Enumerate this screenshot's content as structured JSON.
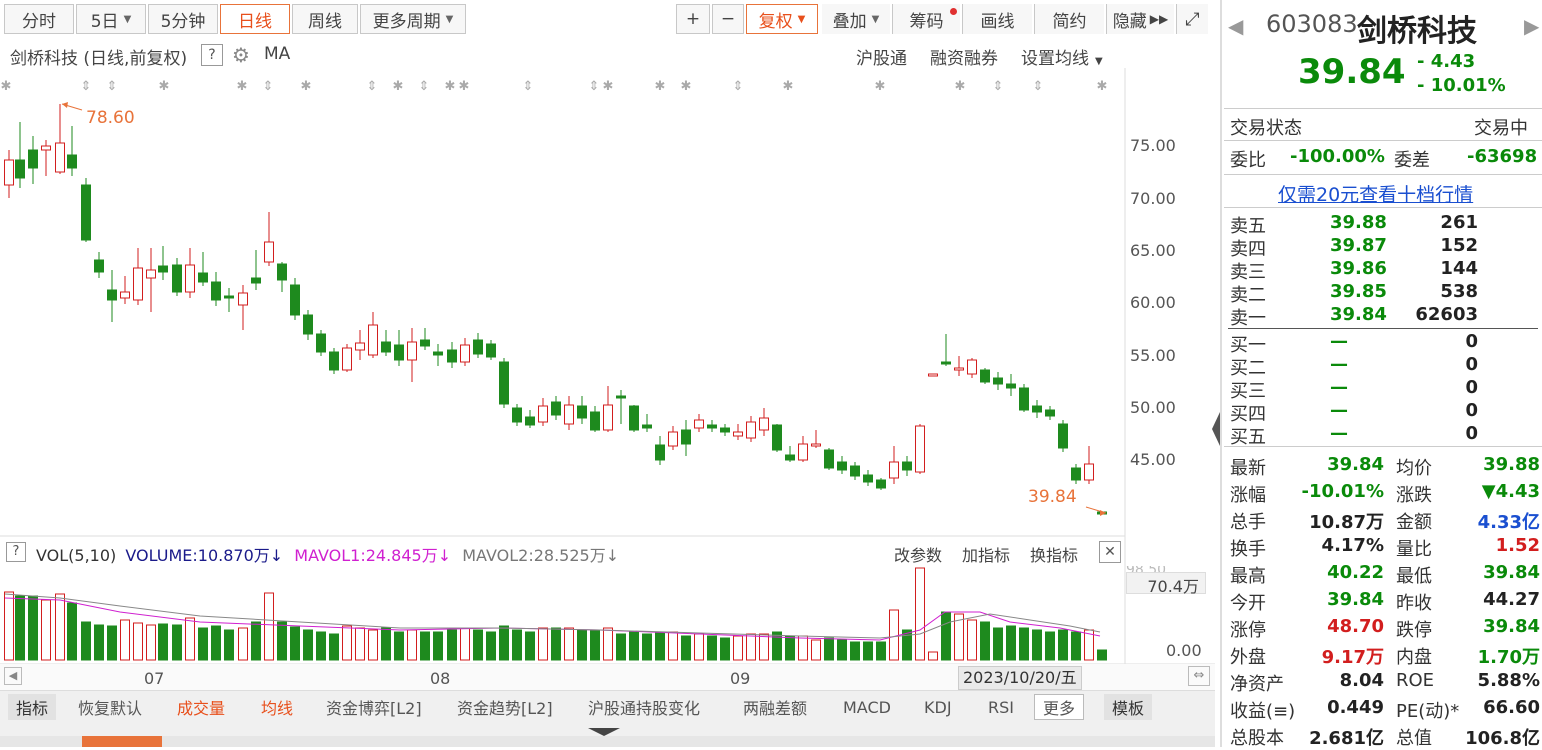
{
  "toolbar": {
    "fenshi": "分时",
    "five_day": "5日",
    "five_min": "5分钟",
    "daily": "日线",
    "weekly": "周线",
    "more_period": "更多周期",
    "plus": "+",
    "minus": "−",
    "fuquan": "复权",
    "diejia": "叠加",
    "chouma": "筹码",
    "huaxian": "画线",
    "jianyue": "简约",
    "yincang": "隐藏"
  },
  "chart_header": {
    "title": "剑桥科技 (日线,前复权)",
    "help": "?",
    "ma": "MA",
    "hgt": "沪股通",
    "rzrq": "融资融券",
    "set_ma": "设置均线"
  },
  "price_axis": [
    "75.00",
    "70.00",
    "65.00",
    "60.00",
    "55.00",
    "50.00",
    "45.00"
  ],
  "annotations": {
    "high": "78.60",
    "low": "39.84"
  },
  "volume_header": {
    "help": "?",
    "vol": "VOL(5,10)",
    "volume": "VOLUME:10.870万",
    "mavol1": "MAVOL1:24.845万",
    "mavol2": "MAVOL2:28.525万",
    "gcs": "改参数",
    "jzb": "加指标",
    "hzb": "换指标",
    "close": "✕"
  },
  "volume_axis": {
    "top": "70.4万",
    "bottom": "0.00",
    "cut": "98.50"
  },
  "x_axis": {
    "labels": [
      "07",
      "08",
      "09"
    ],
    "date": "2023/10/20/五"
  },
  "bottom_tabs": [
    "指标",
    "恢复默认",
    "成交量",
    "均线",
    "资金博弈[L2]",
    "资金趋势[L2]",
    "沪股通持股变化",
    "两融差额",
    "MACD",
    "KDJ",
    "RSI",
    "更多",
    "模板"
  ],
  "stock": {
    "code": "603083",
    "name": "剑桥科技",
    "price": "39.84",
    "change": "- 4.43",
    "pct": "- 10.01%"
  },
  "status": {
    "label": "交易状态",
    "value": "交易中",
    "wb_label": "委比",
    "wb": "-100.00%",
    "wc_label": "委差",
    "wc": "-63698",
    "upsell": "仅需20元查看十档行情"
  },
  "sell": [
    {
      "label": "卖五",
      "price": "39.88",
      "vol": "261"
    },
    {
      "label": "卖四",
      "price": "39.87",
      "vol": "152"
    },
    {
      "label": "卖三",
      "price": "39.86",
      "vol": "144"
    },
    {
      "label": "卖二",
      "price": "39.85",
      "vol": "538"
    },
    {
      "label": "卖一",
      "price": "39.84",
      "vol": "62603"
    }
  ],
  "buy": [
    {
      "label": "买一",
      "price": "—",
      "vol": "0"
    },
    {
      "label": "买二",
      "price": "—",
      "vol": "0"
    },
    {
      "label": "买三",
      "price": "—",
      "vol": "0"
    },
    {
      "label": "买四",
      "price": "—",
      "vol": "0"
    },
    {
      "label": "买五",
      "price": "—",
      "vol": "0"
    }
  ],
  "stats": [
    {
      "l1": "最新",
      "v1": "39.84",
      "c1": "green",
      "l2": "均价",
      "v2": "39.88",
      "c2": "green"
    },
    {
      "l1": "涨幅",
      "v1": "-10.01%",
      "c1": "green",
      "l2": "涨跌",
      "v2": "▼4.43",
      "c2": "green"
    },
    {
      "l1": "总手",
      "v1": "10.87万",
      "c1": "blk",
      "l2": "金额",
      "v2": "4.33亿",
      "c2": "blue"
    },
    {
      "l1": "换手",
      "v1": "4.17%",
      "c1": "blk",
      "l2": "量比",
      "v2": "1.52",
      "c2": "red"
    },
    {
      "l1": "最高",
      "v1": "40.22",
      "c1": "green",
      "l2": "最低",
      "v2": "39.84",
      "c2": "green"
    },
    {
      "l1": "今开",
      "v1": "39.84",
      "c1": "green",
      "l2": "昨收",
      "v2": "44.27",
      "c2": "blk"
    },
    {
      "l1": "涨停",
      "v1": "48.70",
      "c1": "red",
      "l2": "跌停",
      "v2": "39.84",
      "c2": "green"
    },
    {
      "l1": "外盘",
      "v1": "9.17万",
      "c1": "red",
      "l2": "内盘",
      "v2": "1.70万",
      "c2": "green"
    },
    {
      "l1": "净资产",
      "v1": "8.04",
      "c1": "blk",
      "l2": "ROE",
      "v2": "5.88%",
      "c2": "blk"
    },
    {
      "l1": "收益(≡)",
      "v1": "0.449",
      "c1": "blk",
      "l2": "PE(动)*",
      "v2": "66.60",
      "c2": "blk"
    },
    {
      "l1": "总股本",
      "v1": "2.681亿",
      "c1": "blk",
      "l2": "总值",
      "v2": "106.8亿",
      "c2": "blk"
    }
  ],
  "colors": {
    "up": "#d21e1e",
    "down": "#1e8a1e",
    "accent": "#e8733a",
    "ma_pink": "#d020d0"
  }
}
